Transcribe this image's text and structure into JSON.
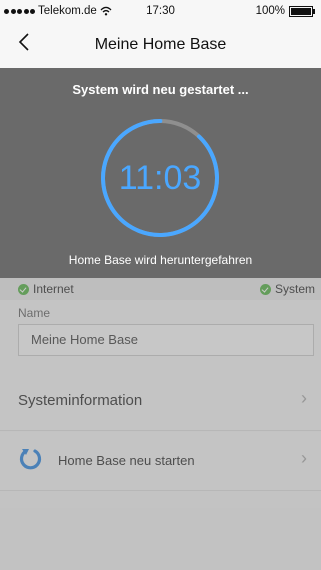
{
  "status_bar": {
    "carrier": "Telekom.de",
    "time": "17:30",
    "battery": "100%"
  },
  "nav": {
    "back_icon": "chevron-left",
    "title": "Meine Home Base"
  },
  "overlay": {
    "title": "System wird neu gestartet ...",
    "timer": "11:03",
    "subtitle": "Home Base wird heruntergefahren",
    "progress_fraction": 0.88,
    "accent_color": "#4aa7ff"
  },
  "status_row": {
    "internet_label": "Internet",
    "system_label": "System",
    "ok_color": "#58b34a"
  },
  "name_section": {
    "label": "Name",
    "value": "Meine Home Base"
  },
  "menu": {
    "systeminfo_label": "Systeminformation",
    "restart_label": "Home Base neu starten"
  }
}
